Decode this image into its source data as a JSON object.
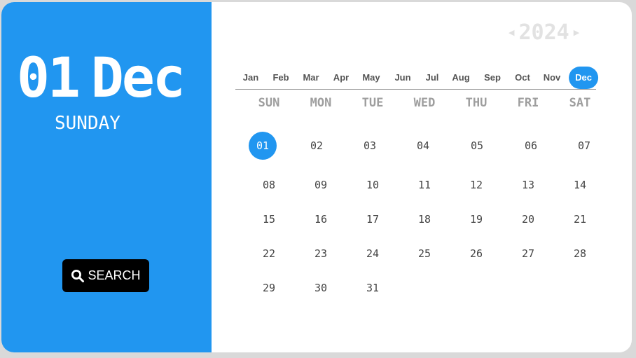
{
  "selected": {
    "day": "01",
    "month": "Dec",
    "weekday": "SUNDAY"
  },
  "search": {
    "label": "SEARCH",
    "icon": "search-icon"
  },
  "year": {
    "value": "2024",
    "prev_icon": "caret-left-icon",
    "next_icon": "caret-right-icon"
  },
  "months": [
    "Jan",
    "Feb",
    "Mar",
    "Apr",
    "May",
    "Jun",
    "Jul",
    "Aug",
    "Sep",
    "Oct",
    "Nov",
    "Dec"
  ],
  "active_month_index": 11,
  "weekdays": [
    "SUN",
    "MON",
    "TUE",
    "WED",
    "THU",
    "FRI",
    "SAT"
  ],
  "weeks": [
    [
      "01",
      "02",
      "03",
      "04",
      "05",
      "06",
      "07"
    ],
    [
      "08",
      "09",
      "10",
      "11",
      "12",
      "13",
      "14"
    ],
    [
      "15",
      "16",
      "17",
      "18",
      "19",
      "20",
      "21"
    ],
    [
      "22",
      "23",
      "24",
      "25",
      "26",
      "27",
      "28"
    ],
    [
      "29",
      "30",
      "31"
    ]
  ],
  "selected_day": "01",
  "colors": {
    "accent": "#2196f0",
    "button": "#000000"
  }
}
